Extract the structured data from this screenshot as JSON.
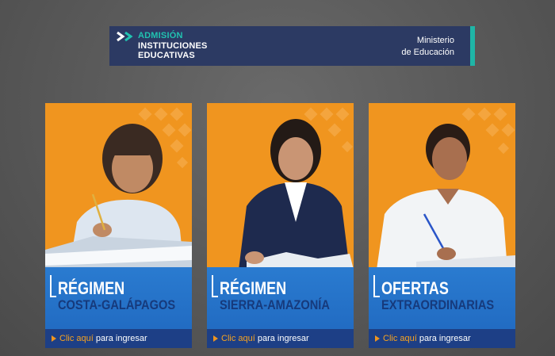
{
  "header": {
    "brand_line1": "ADMISIÓN",
    "brand_line2": "INSTITUCIONES",
    "brand_line3": "EDUCATIVAS",
    "ministry_line1": "Ministerio",
    "ministry_line2": "de Educación"
  },
  "cards": [
    {
      "title": "RÉGIMEN",
      "subtitle": "COSTA-GALÁPAGOS",
      "cta_link": "Clic aquí",
      "cta_text": "para ingresar",
      "icon": "girl-student-photo"
    },
    {
      "title": "RÉGIMEN",
      "subtitle": "SIERRA-AMAZONÍA",
      "cta_link": "Clic aquí",
      "cta_text": "para ingresar",
      "icon": "teen-student-photo"
    },
    {
      "title": "OFERTAS",
      "subtitle": "EXTRAORDINARIAS",
      "cta_link": "Clic aquí",
      "cta_text": "para ingresar",
      "icon": "adult-student-photo"
    }
  ],
  "colors": {
    "banner_bg": "#2c3a63",
    "brand_teal": "#21c2b0",
    "card_orange": "#f0951f",
    "card_blue": "#1f67be",
    "cta_navy": "#1d3f86"
  }
}
